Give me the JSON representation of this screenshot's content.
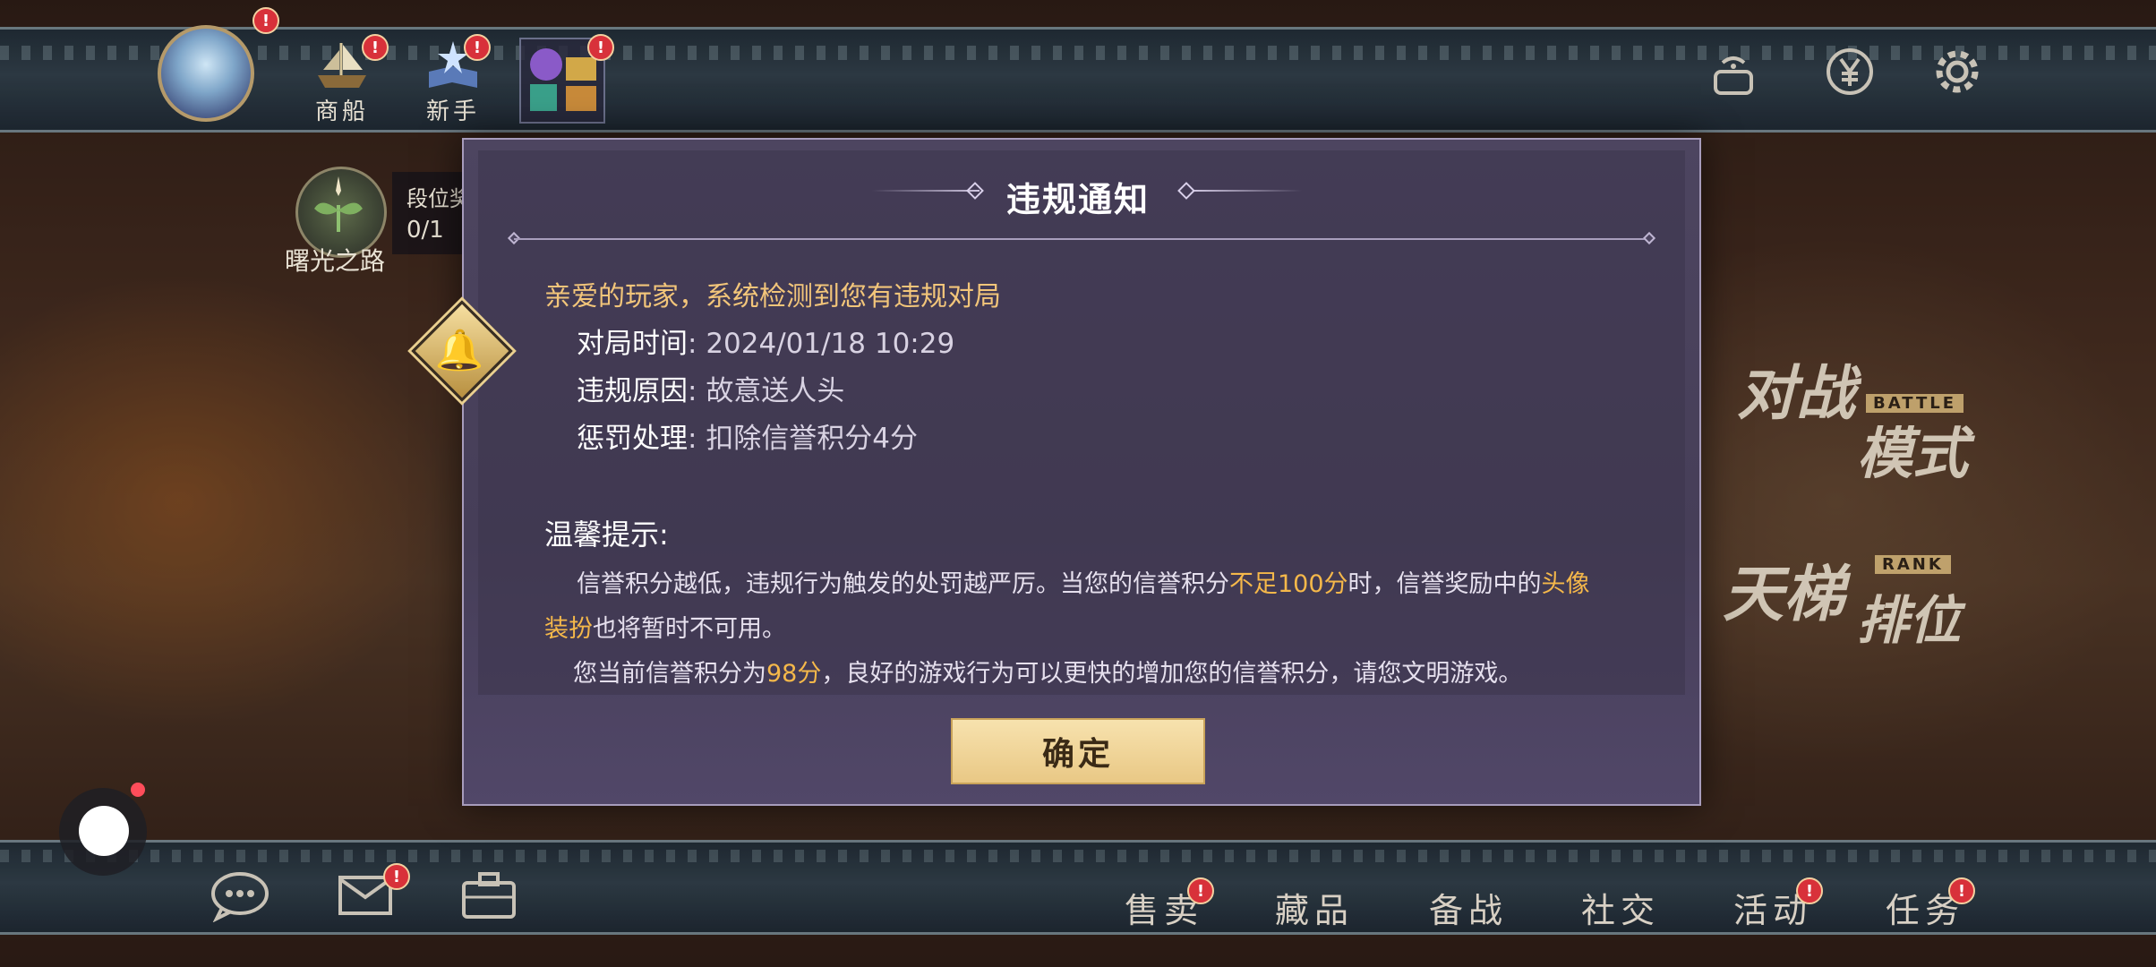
{
  "top": {
    "nav": [
      {
        "label": "商船",
        "badge": "!"
      },
      {
        "label": "新手",
        "badge": "!"
      },
      {
        "label": "",
        "badge": "!"
      }
    ],
    "avatar_badge": "!",
    "right_icons": [
      "game-controller-icon",
      "currency-yuan-icon",
      "gear-icon"
    ]
  },
  "side": {
    "dawn_road_label": "曙光之路",
    "rank_label": "段位奖",
    "rank_progress": "0/1"
  },
  "modes": {
    "battle_title_1": "对战",
    "battle_title_2": "模式",
    "battle_tag": "BATTLE",
    "rank_title_1": "天梯",
    "rank_title_2": "排位",
    "rank_tag": "RANK"
  },
  "dialog": {
    "title": "违规通知",
    "greeting": "亲爱的玩家，系统检测到您有违规对局",
    "details": [
      {
        "key": "对局时间",
        "value": "2024/01/18 10:29"
      },
      {
        "key": "违规原因",
        "value": "故意送人头"
      },
      {
        "key": "惩罚处理",
        "value": "扣除信誉积分4分"
      }
    ],
    "hint_heading": "温馨提示:",
    "para1_a": "信誉积分越低，违规行为触发的处罚越严厉。当您的信誉积分",
    "para1_hl1": "不足100分",
    "para1_b": "时，信誉奖励中的",
    "para1_hl2": "头像",
    "para1_hl3": "装扮",
    "para1_c": "也将暂时不可用。",
    "para2_a": "您当前信誉积分为",
    "para2_hl": "98分",
    "para2_b": "，良好的游戏行为可以更快的增加您的信誉积分，请您文明游戏。",
    "confirm_label": "确定"
  },
  "bottom": {
    "nav": [
      {
        "label": "售卖",
        "badge": "!"
      },
      {
        "label": "藏品",
        "badge": ""
      },
      {
        "label": "备战",
        "badge": ""
      },
      {
        "label": "社交",
        "badge": ""
      },
      {
        "label": "活动",
        "badge": "!"
      },
      {
        "label": "任务",
        "badge": "!"
      }
    ],
    "icons": [
      "chat-bubble-icon",
      "mail-icon",
      "briefcase-icon"
    ],
    "mail_badge": "!"
  },
  "colors": {
    "highlight": "#f5b84a",
    "greeting": "#f2c57a",
    "dialog_bg": "#4d4560",
    "button": "#f0d598"
  }
}
